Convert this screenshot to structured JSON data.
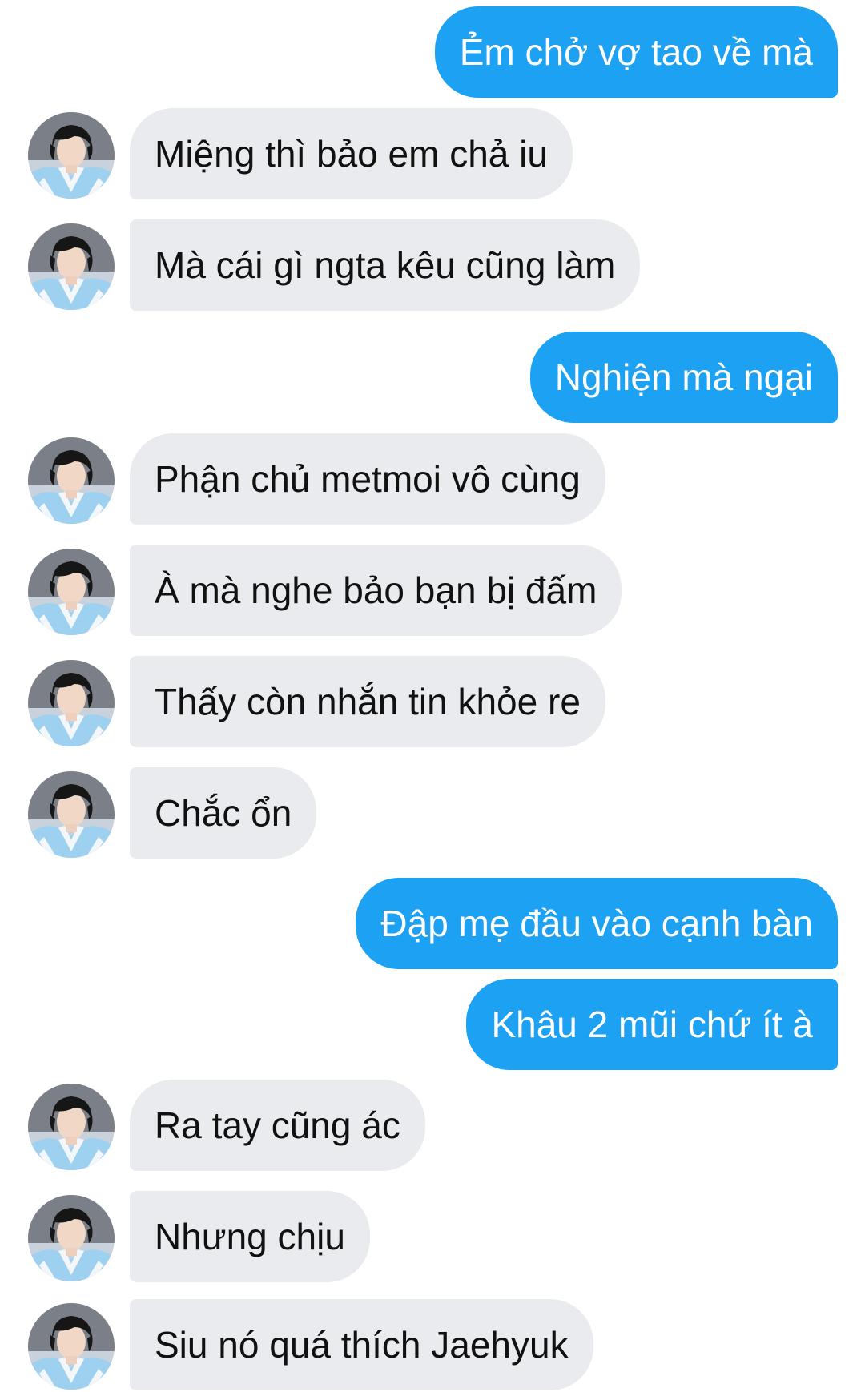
{
  "conversation": {
    "messages": [
      {
        "side": "out",
        "text": "Ẻm chở vợ tao về mà"
      },
      {
        "side": "in",
        "text": "Miệng thì bảo em chả iu"
      },
      {
        "side": "in",
        "text": "Mà cái gì ngta kêu cũng làm"
      },
      {
        "side": "out",
        "text": "Nghiện mà ngại"
      },
      {
        "side": "in",
        "text": "Phận chủ metmoi vô cùng"
      },
      {
        "side": "in",
        "text": "À mà nghe bảo bạn bị đấm"
      },
      {
        "side": "in",
        "text": "Thấy còn nhắn tin khỏe re"
      },
      {
        "side": "in",
        "text": "Chắc ổn"
      },
      {
        "side": "out",
        "text": "Đập mẹ đầu vào cạnh bàn"
      },
      {
        "side": "out",
        "text": "Khâu 2 mũi chứ ít à"
      },
      {
        "side": "in",
        "text": "Ra tay cũng ác"
      },
      {
        "side": "in",
        "text": "Nhưng chịu"
      },
      {
        "side": "in",
        "text": "Siu nó quá thích Jaehyuk"
      }
    ]
  },
  "colors": {
    "outgoing_bubble": "#1da1f2",
    "incoming_bubble": "#e9ebef",
    "outgoing_text": "#ffffff",
    "incoming_text": "#111111"
  },
  "icons": {
    "avatar": "user-avatar-photo"
  }
}
